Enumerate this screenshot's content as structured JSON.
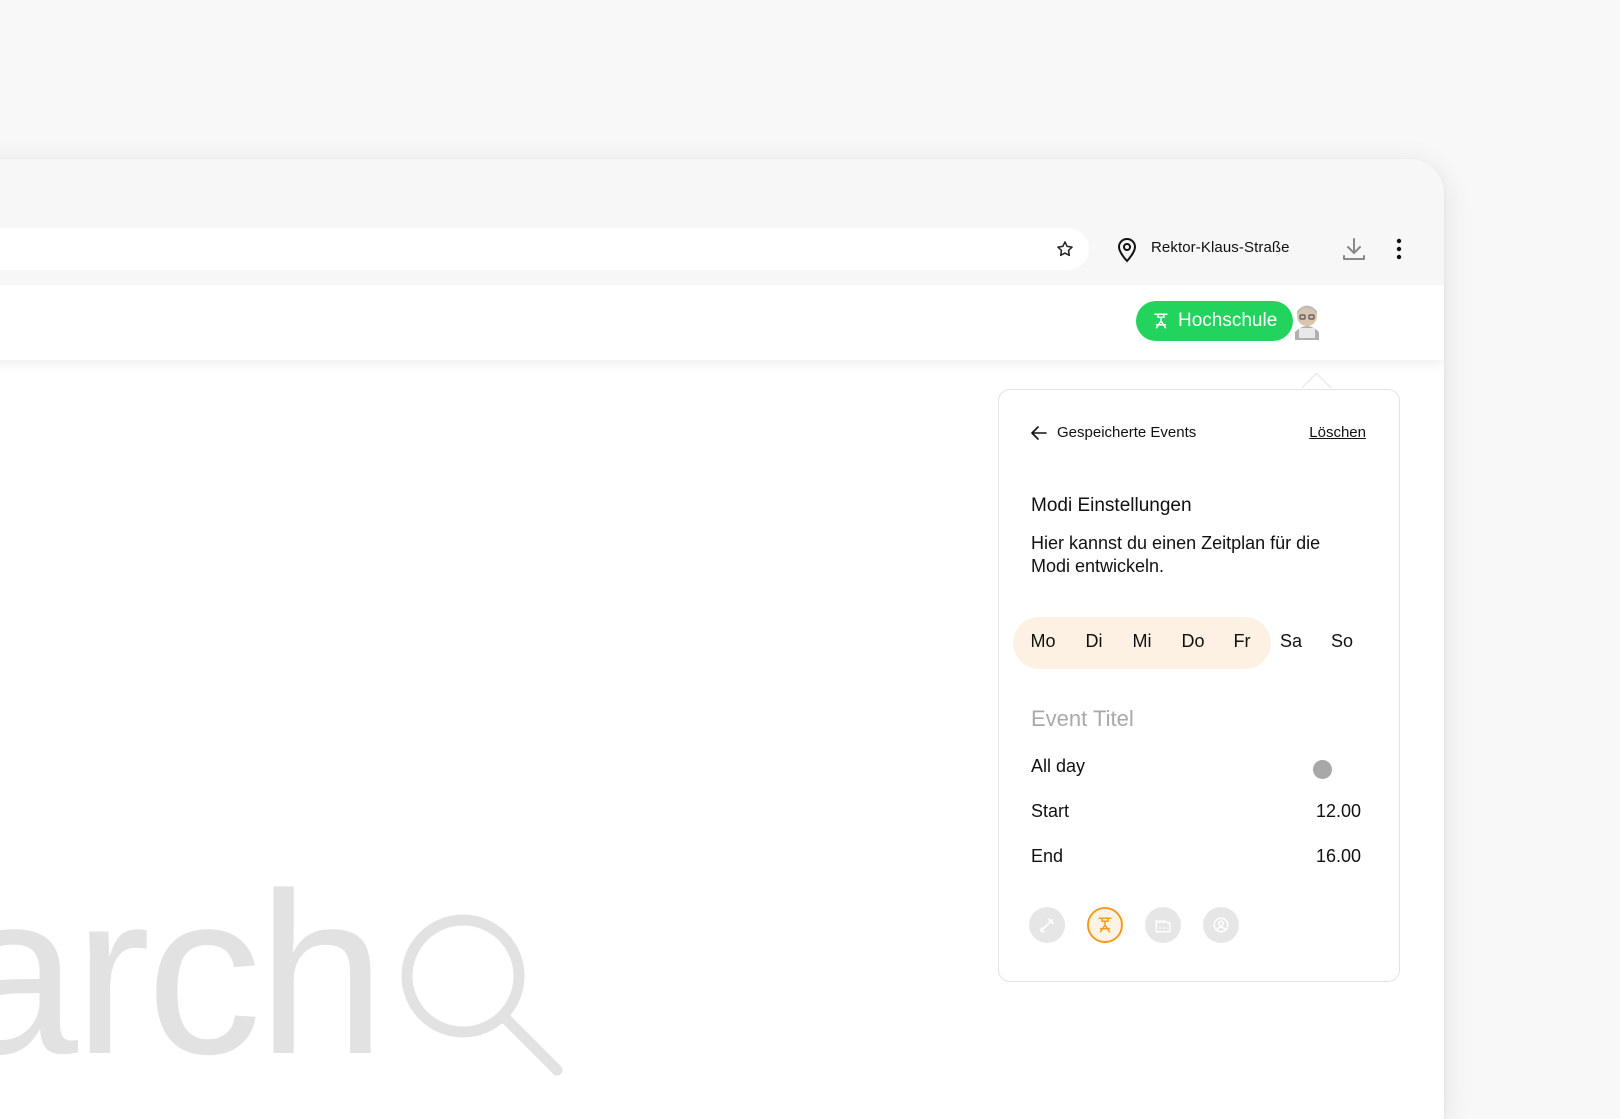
{
  "browser": {
    "location_label": "Rektor-Klaus-Straße"
  },
  "header": {
    "mode_pill_label": "Hochschule"
  },
  "background": {
    "search_word": "arch"
  },
  "popup": {
    "back_label": "Gespeicherte Events",
    "clear_label": "Löschen",
    "title": "Modi Einstellungen",
    "description": "Hier kannst du einen Zeitplan für die Modi entwickeln.",
    "days": [
      "Mo",
      "Di",
      "Mi",
      "Do",
      "Fr",
      "Sa",
      "So"
    ],
    "selected_days": [
      "Mo",
      "Di",
      "Mi",
      "Do",
      "Fr"
    ],
    "event_title_placeholder": "Event Titel",
    "all_day_label": "All day",
    "all_day_on": false,
    "start_label": "Start",
    "start_value": "12.00",
    "end_label": "End",
    "end_value": "16.00",
    "modes": [
      {
        "icon": "pen-icon",
        "active": false
      },
      {
        "icon": "graduation-icon",
        "active": true
      },
      {
        "icon": "building-icon",
        "active": false
      },
      {
        "icon": "user-circle-icon",
        "active": false
      }
    ],
    "accent_color": "#f39c1f",
    "selection_color": "#fdf1e4"
  },
  "colors": {
    "pill_green": "#22d35e"
  }
}
